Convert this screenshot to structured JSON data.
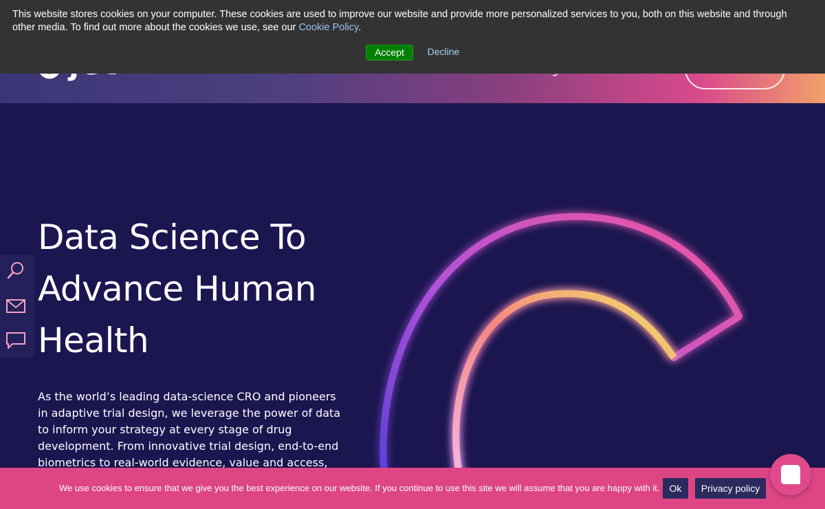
{
  "header": {
    "logo_text": "jet",
    "nav_fragment": "g"
  },
  "cookie_banner_top": {
    "message": "This website stores cookies on your computer. These cookies are used to improve our website and provide more personalized services to you, both on this website and through other media. To find out more about the cookies we use, see our",
    "policy_link": "Cookie Policy",
    "policy_suffix": ".",
    "accept_label": "Accept",
    "decline_label": "Decline",
    "background_color": "#333333",
    "accept_color": "#008000"
  },
  "hero": {
    "title_line1": "Data Science To",
    "title_line2": "Advance Human",
    "title_line3": "Health",
    "description": "As the world’s leading data-science CRO and pioneers in adaptive trial design, we leverage the power of data to inform your strategy at every stage of drug development. From innovative trial design, end-to-end biometrics to real-world evidence, value and access, we strive to"
  },
  "side_toolbar": {
    "items": [
      {
        "icon": "search-icon"
      },
      {
        "icon": "mail-icon"
      },
      {
        "icon": "chat-icon"
      }
    ]
  },
  "cookie_bar_bottom": {
    "message": "We use cookies to ensure that we give you the best experience on our website. If you continue to use this site we will assume that you are happy with it.",
    "ok_label": "Ok",
    "privacy_label": "Privacy policy",
    "close_label": "×",
    "background_color": "#dd4584",
    "button_color": "#2b2a5e"
  },
  "chat_widget": {
    "icon": "chat-bubble-icon",
    "color": "#e04a8c"
  }
}
